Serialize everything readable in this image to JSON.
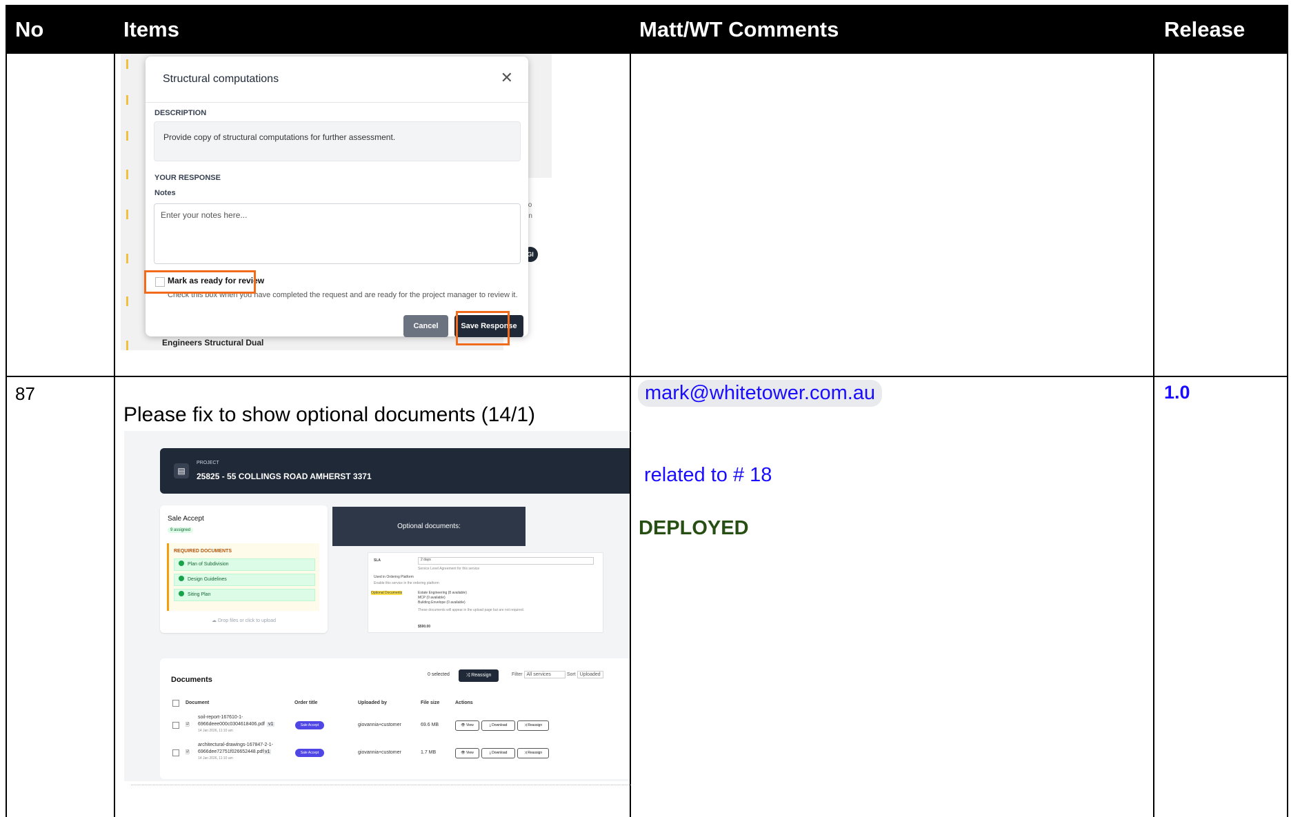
{
  "header": {
    "col_no": "No",
    "col_items": "Items",
    "col_comments": "Matt/WT Comments",
    "col_release": "Release"
  },
  "row_prev": {
    "modal": {
      "title": "Structural computations",
      "close_icon": "close-icon",
      "description_label": "DESCRIPTION",
      "description_text": "Provide copy of structural computations for further assessment.",
      "response_label": "YOUR RESPONSE",
      "notes_label": "Notes",
      "notes_placeholder": "Enter your notes here...",
      "checkbox_label": "Mark as ready for review",
      "checkbox_help": "Check this box when you have completed the request and are ready for the project manager to review it.",
      "cancel_label": "Cancel",
      "save_label": "Save Response",
      "highlight_color": "#f26a1b"
    },
    "background_text": "Engineers Structural Dual",
    "background_avatar": "GI",
    "background_frag_1": "F",
    "background_frag_2": "ck co",
    "background_frag_3": "ste in"
  },
  "row_87": {
    "no": "87",
    "item_text": "Please fix to show optional documents (14/1)",
    "comment_email": "mark@whitetower.com.au",
    "comment_related": "related to # 18",
    "comment_status": "DEPLOYED",
    "release": "1.0",
    "screenshot": {
      "project_label": "PROJECT",
      "project_name": "25825 - 55 COLLINGS ROAD AMHERST 3371",
      "card_title": "Sale Accept",
      "card_badge": "9 assigned",
      "required_header": "REQUIRED DOCUMENTS",
      "required_items": [
        "Plan of Subdivision",
        "Design Guidelines",
        "Siting Plan"
      ],
      "drop_text": "Drop files or click to upload",
      "optional_box": "Optional documents:",
      "svc_sla_label": "SLA",
      "svc_sla_value": "2 days",
      "svc_sla_help": "Service Level Agreement for this service",
      "svc_used": "Used in Ordering Platform",
      "svc_used_help": "Enable this service in the ordering platform",
      "svc_optional_label": "Optional Documents",
      "svc_optional_items": [
        "Estate Engineering (8 available)",
        "MCP (0 available)",
        "Building Envelope (0 available)"
      ],
      "svc_optional_help": "These documents will appear in the upload page but are not required.",
      "svc_price": "$590.00",
      "docs_title": "Documents",
      "docs_selected": "0 selected",
      "docs_reassign": "Reassign",
      "docs_filter": "Filter",
      "docs_filter_value": "All services",
      "docs_sort": "Sort",
      "docs_sort_value": "Uploaded",
      "columns": [
        "Document",
        "Order title",
        "Uploaded by",
        "File size",
        "Actions"
      ],
      "rows": [
        {
          "name_line1": "soil-report-167610-1-",
          "name_line2": "6966deee000c0304618406.pdf",
          "version": "v1",
          "date": "14 Jan 2026, 11:10 am",
          "order": "Sale Accept",
          "uploader": "giovannia+customer",
          "size": "69.6 MB"
        },
        {
          "name_line1": "architectural-drawings-167847-2-1-",
          "name_line2": "6966dee72751f026652448.pdf",
          "version": "v1",
          "date": "14 Jan 2026, 11:10 am",
          "order": "Sale Accept",
          "uploader": "giovannia+customer",
          "size": "1.7 MB"
        }
      ],
      "action_view": "View",
      "action_download": "Download",
      "action_reassign": "Reassign"
    }
  },
  "colors": {
    "header_bg": "#000000",
    "link_blue": "#1a0dff",
    "deployed_green": "#274e13",
    "email_chip_bg": "#e8eaed"
  }
}
